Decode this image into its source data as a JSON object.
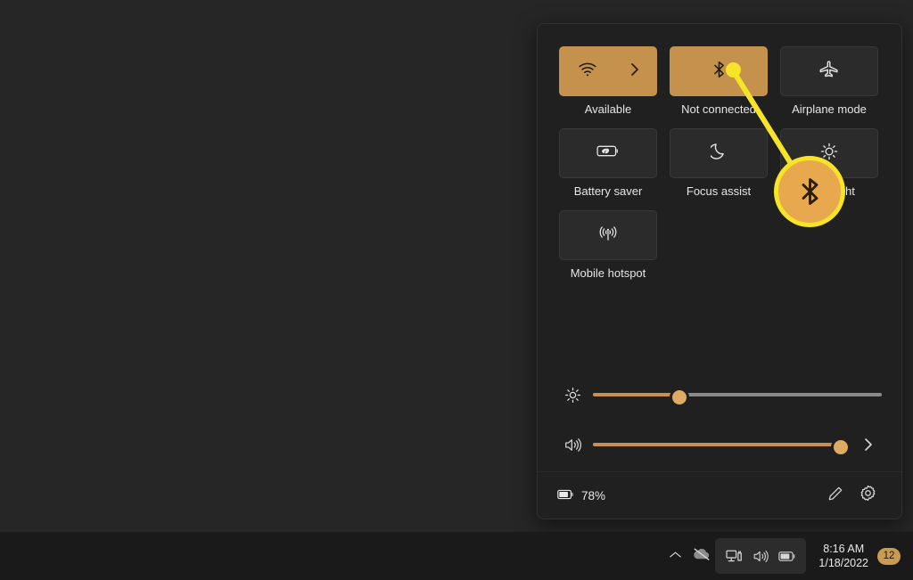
{
  "desktop": {
    "background_color": "#262626"
  },
  "taskbar": {
    "background_color": "#1a1a1a",
    "show_hidden_icons_label": "Show hidden icons",
    "network_status_label": "Network offline",
    "tray_icons": [
      {
        "name": "chevron-up-icon",
        "label": "Show hidden icons"
      },
      {
        "name": "cloud-offline-icon",
        "label": "OneDrive not connected"
      }
    ],
    "tray_group": [
      {
        "name": "network-icon",
        "label": "Network"
      },
      {
        "name": "volume-icon",
        "label": "Volume"
      },
      {
        "name": "battery-icon",
        "label": "Battery"
      }
    ],
    "clock": {
      "time": "8:16 AM",
      "date": "1/18/2022"
    },
    "notifications": {
      "count": "12",
      "badge_color": "#c79b52"
    }
  },
  "panel": {
    "name": "quick-settings-panel",
    "accent_color": "#c4924c",
    "tiles": [
      {
        "id": "wifi",
        "label": "Available",
        "icon": "wifi-icon",
        "active": true,
        "has_chevron": true,
        "chevron_icon": "chevron-right-icon"
      },
      {
        "id": "bluetooth",
        "label": "Not connected",
        "icon": "bluetooth-icon",
        "active": true,
        "has_chevron": false
      },
      {
        "id": "airplane-mode",
        "label": "Airplane mode",
        "icon": "airplane-icon",
        "active": false,
        "has_chevron": false
      },
      {
        "id": "battery-saver",
        "label": "Battery saver",
        "icon": "battery-saver-icon",
        "active": false,
        "has_chevron": false
      },
      {
        "id": "focus-assist",
        "label": "Focus assist",
        "icon": "moon-icon",
        "active": false,
        "has_chevron": false
      },
      {
        "id": "night-light",
        "label": "Night light",
        "icon": "night-light-icon",
        "active": false,
        "has_chevron": false
      },
      {
        "id": "mobile-hotspot",
        "label": "Mobile hotspot",
        "icon": "hotspot-icon",
        "active": false,
        "has_chevron": false
      }
    ],
    "sliders": [
      {
        "id": "brightness",
        "icon": "brightness-icon",
        "value": 29,
        "min": 0,
        "max": 100,
        "has_chevron": false
      },
      {
        "id": "volume",
        "icon": "volume-icon",
        "value": 96,
        "min": 0,
        "max": 100,
        "has_chevron": true,
        "chevron_icon": "chevron-right-icon"
      }
    ],
    "footer": {
      "battery_icon": "battery-icon",
      "battery_percent": "78%",
      "edit_icon": "pencil-icon",
      "settings_icon": "gear-icon"
    }
  },
  "annotation": {
    "highlight_icon": "bluetooth-icon",
    "ring_color": "#f7e327",
    "fill_color": "#e8a84e"
  }
}
